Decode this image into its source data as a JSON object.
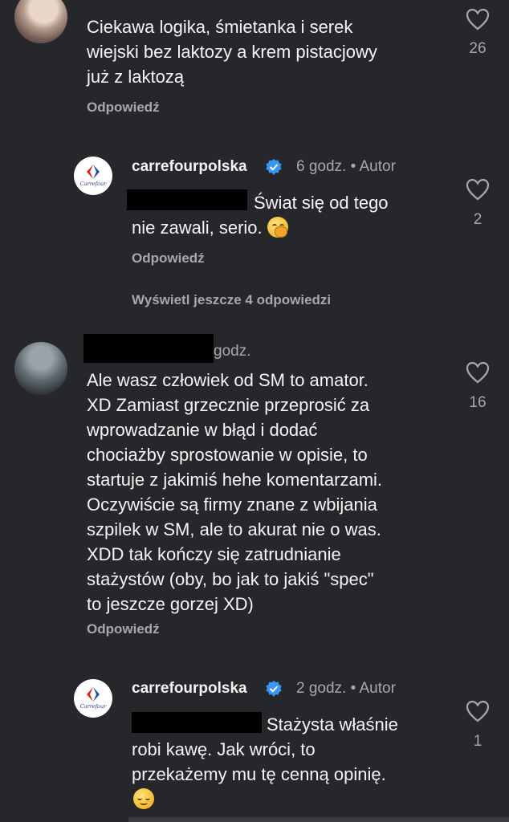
{
  "comments": [
    {
      "id": "c1",
      "author": "",
      "text_lines": [
        "Ciekawa logika, śmietanka i serek",
        "wiejski bez laktozy a krem pistacjowy",
        "już z laktozą"
      ],
      "reply_label": "Odpowiedź",
      "likes": "26"
    },
    {
      "id": "r1",
      "author": "carrefourpolska",
      "time": "6 godz.",
      "role": "Autor",
      "text_lines": [
        "Świat się od tego",
        "nie zawali, serio."
      ],
      "reply_label": "Odpowiedź",
      "likes": "2",
      "view_more": "Wyświetl jeszcze 4 odpowiedzi"
    },
    {
      "id": "c2",
      "time_fragment": "godz.",
      "text_lines": [
        "Ale wasz człowiek od SM to amator.",
        "XD Zamiast grzecznie przeprosić za",
        "wprowadzanie w błąd i dodać",
        "chociażby sprostowanie w opisie, to",
        "startuje z jakimiś hehe komentarzami.",
        "Oczywiście są firmy znane z wbijania",
        "szpilek w SM, ale to akurat nie o was.",
        "XDD tak kończy się zatrudnianie",
        "stażystów (oby, bo jak to jakiś \"spec\"",
        "to jeszcze gorzej XD)"
      ],
      "reply_label": "Odpowiedź",
      "likes": "16"
    },
    {
      "id": "r2",
      "author": "carrefourpolska",
      "time": "2 godz.",
      "role": "Autor",
      "text_lines": [
        "Stażysta właśnie",
        "robi kawę. Jak wróci, to",
        "przekażemy mu tę cenną opinię."
      ],
      "likes": "1"
    }
  ],
  "brand": {
    "logo_text": "Carrefour",
    "blue": "#1e4fa3",
    "red": "#e1251b"
  },
  "colors": {
    "background": "#26272b",
    "text": "#f5f5f5",
    "muted": "#a8a8a8",
    "verified": "#3897f0"
  },
  "icons": [
    "heart-icon",
    "verified-badge-icon",
    "carrefour-logo-icon",
    "emoji-hand-over-mouth",
    "emoji-relieved-face"
  ]
}
